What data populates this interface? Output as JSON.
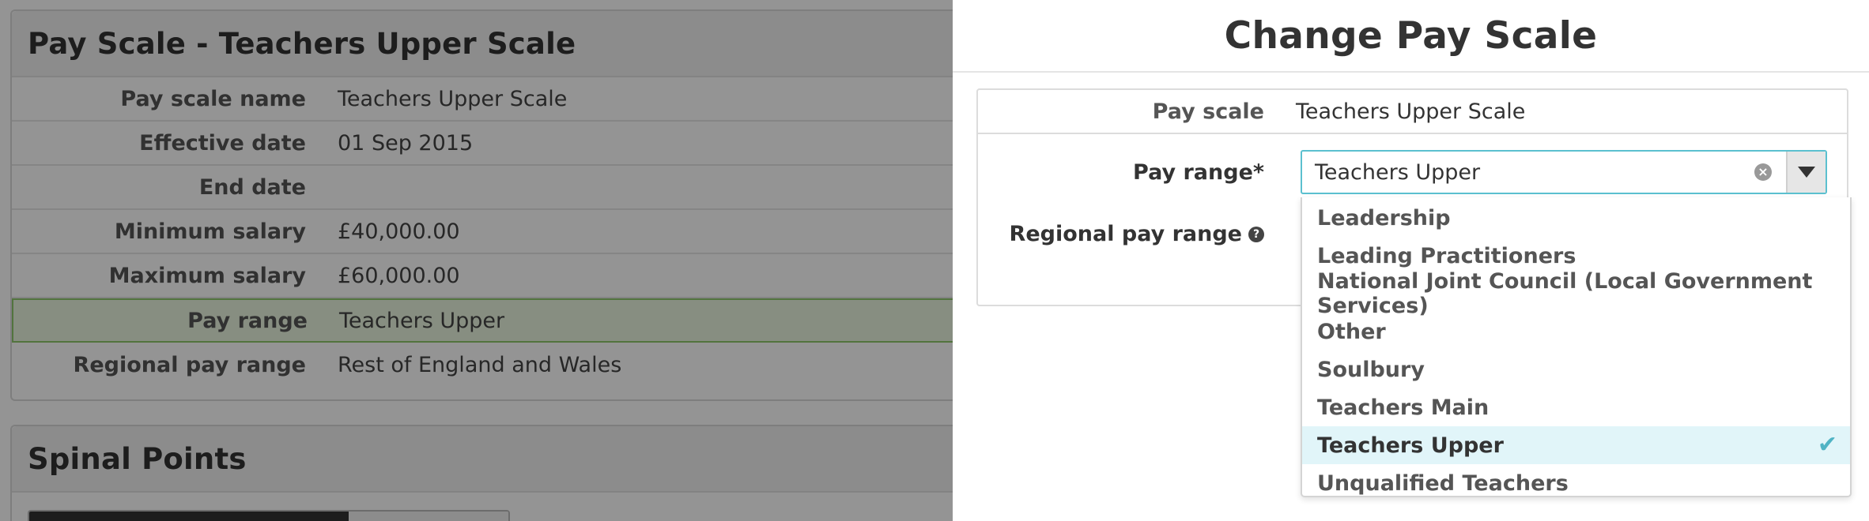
{
  "background_page": {
    "details": {
      "title": "Pay Scale - Teachers Upper Scale",
      "rows": [
        {
          "label": "Pay scale name",
          "value": "Teachers Upper Scale"
        },
        {
          "label": "Effective date",
          "value": "01 Sep 2015"
        },
        {
          "label": "End date",
          "value": ""
        },
        {
          "label": "Minimum salary",
          "value": "£40,000.00"
        },
        {
          "label": "Maximum salary",
          "value": "£60,000.00"
        },
        {
          "label": "Pay range",
          "value": "Teachers Upper"
        },
        {
          "label": "Regional pay range",
          "value": "Rest of England and Wales"
        }
      ]
    },
    "spinal": {
      "title": "Spinal Points"
    }
  },
  "modal": {
    "title": "Change Pay Scale",
    "pay_scale": {
      "label": "Pay scale",
      "value": "Teachers Upper Scale"
    },
    "pay_range": {
      "label": "Pay range*",
      "selected": "Teachers Upper"
    },
    "regional_pay_range": {
      "label": "Regional pay range"
    },
    "dropdown_options": [
      "Leadership",
      "Leading Practitioners",
      "National Joint Council (Local Government Services)",
      "Other",
      "Soulbury",
      "Teachers Main",
      "Teachers Upper",
      "Unqualified Teachers"
    ]
  },
  "colors": {
    "select_border": "#5bc0cf",
    "selected_option_bg": "#e1f5f9",
    "highlight_row_bg": "#e9f5df",
    "highlight_row_border": "#8ec96b"
  }
}
